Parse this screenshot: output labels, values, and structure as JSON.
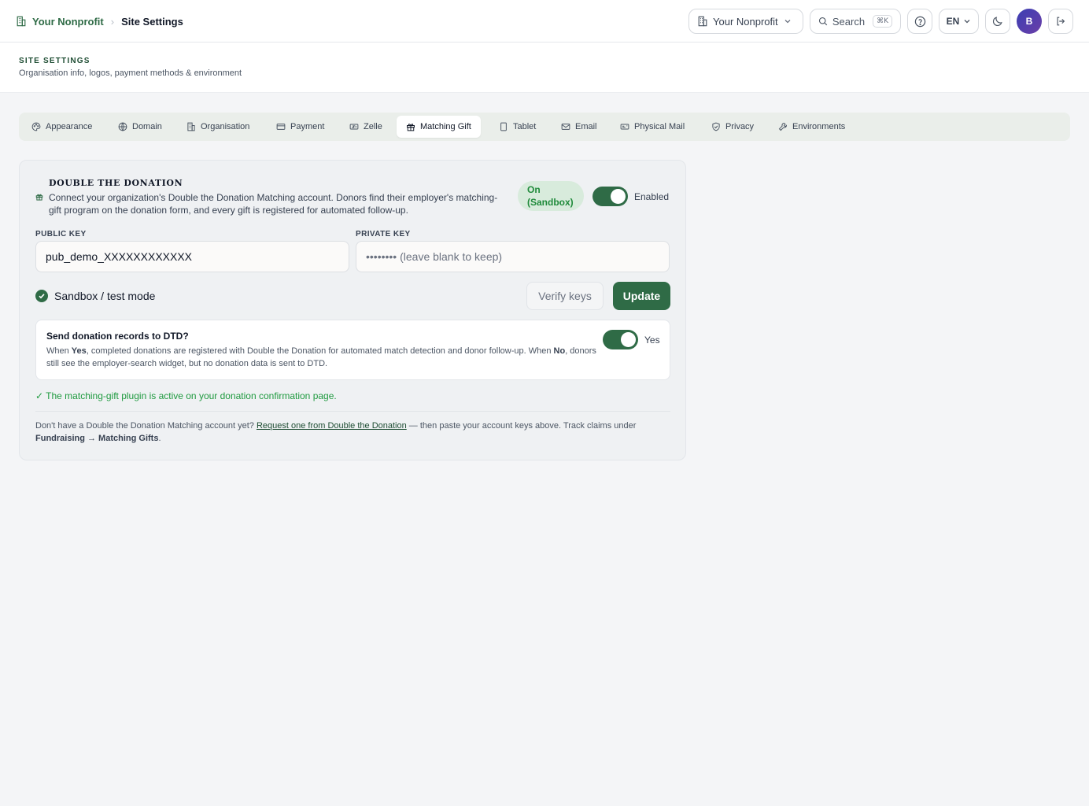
{
  "breadcrumb": {
    "org": "Your Nonprofit",
    "separator": "›",
    "current": "Site Settings"
  },
  "topbar": {
    "org_switcher": "Your Nonprofit",
    "search_label": "Search",
    "search_shortcut": "⌘K",
    "language": "EN",
    "avatar_initial": "B"
  },
  "header": {
    "title": "SITE SETTINGS",
    "subtitle": "Organisation info, logos, payment methods & environment"
  },
  "tabs": [
    {
      "label": "Appearance",
      "icon": "palette-icon"
    },
    {
      "label": "Domain",
      "icon": "globe-icon"
    },
    {
      "label": "Organisation",
      "icon": "building-icon"
    },
    {
      "label": "Payment",
      "icon": "credit-card-icon"
    },
    {
      "label": "Zelle",
      "icon": "zelle-icon"
    },
    {
      "label": "Matching Gift",
      "icon": "gift-icon",
      "active": true
    },
    {
      "label": "Tablet",
      "icon": "tablet-icon"
    },
    {
      "label": "Email",
      "icon": "mail-icon"
    },
    {
      "label": "Physical Mail",
      "icon": "envelope-card-icon"
    },
    {
      "label": "Privacy",
      "icon": "shield-icon"
    },
    {
      "label": "Environments",
      "icon": "wrench-icon"
    }
  ],
  "dtd": {
    "title": "DOUBLE THE DONATION",
    "description": "Connect your organization's Double the Donation Matching account. Donors find their employer's matching-gift program on the donation form, and every gift is registered for automated follow-up.",
    "status_badge": "On (Sandbox)",
    "enabled_label": "Enabled",
    "enabled": true,
    "public_key_label": "PUBLIC KEY",
    "public_key_value": "pub_demo_XXXXXXXXXXXX",
    "private_key_label": "PRIVATE KEY",
    "private_key_placeholder": "•••••••• (leave blank to keep)",
    "sandbox_label": "Sandbox / test mode",
    "sandbox_checked": true,
    "verify_button": "Verify keys",
    "update_button": "Update",
    "send_records": {
      "title": "Send donation records to DTD?",
      "desc_when": "When ",
      "desc_yes_bold": "Yes",
      "desc_mid": ", completed donations are registered with Double the Donation for automated match detection and donor follow-up. When ",
      "desc_no_bold": "No",
      "desc_end": ", donors still see the employer-search widget, but no donation data is sent to DTD.",
      "toggle_label": "Yes",
      "enabled": true
    },
    "plugin_message": "✓ The matching-gift plugin is active on your donation confirmation page.",
    "footer_prefix": "Don't have a Double the Donation Matching account yet? ",
    "footer_link": "Request one from Double the Donation",
    "footer_mid": " — then paste your account keys above. Track claims under ",
    "footer_path_bold": "Fundraising → Matching Gifts",
    "footer_end": "."
  }
}
